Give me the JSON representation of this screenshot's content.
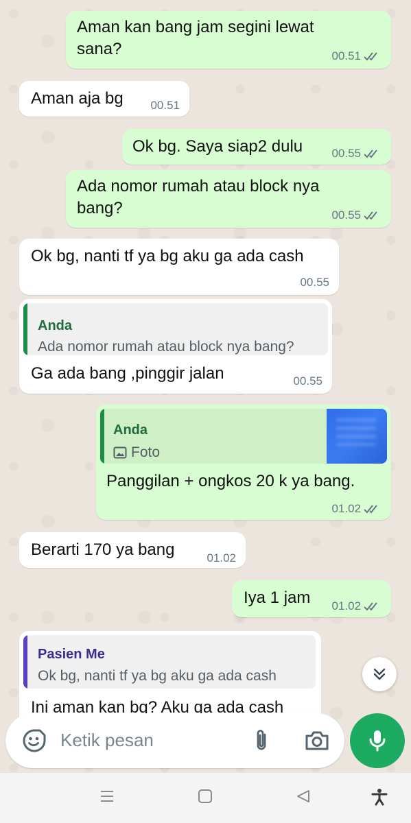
{
  "messages": [
    {
      "text": "Aman kan bang jam segini lewat\nsana?",
      "time": "00.51"
    },
    {
      "text": "Aman aja bg",
      "time": "00.51"
    },
    {
      "text": "Ok bg. Saya siap2 dulu",
      "time": "00.55"
    },
    {
      "text": "Ada nomor rumah atau block nya\nbang?",
      "time": "00.55"
    },
    {
      "text": "Ok bg, nanti tf ya bg aku ga ada cash",
      "time": "00.55"
    },
    {
      "quote_name": "Anda",
      "quote_text": "Ada nomor rumah atau block nya bang?",
      "text": "Ga ada bang ,pinggir jalan",
      "time": "00.55"
    },
    {
      "quote_name": "Anda",
      "quote_text": "Foto",
      "text": "Panggilan + ongkos 20 k ya bang.",
      "time": "01.02"
    },
    {
      "text": "Berarti 170 ya bang",
      "time": "01.02"
    },
    {
      "text": "Iya 1 jam",
      "time": "01.02"
    },
    {
      "quote_name": "Pasien Me",
      "quote_text": "Ok bg, nanti tf ya bg aku ga ada cash",
      "text": "Ini aman kan bg? Aku ga ada cash"
    }
  ],
  "input": {
    "placeholder": "Ketik pesan"
  },
  "colors": {
    "outgoing_bubble": "#d9fdd3",
    "incoming_bubble": "#ffffff",
    "quote_anda": "#1f8a4c",
    "quote_pasien": "#5a3fc0",
    "read_ticks": "#667781",
    "mic_button": "#1daa61"
  },
  "icons": {
    "read_receipt": "double-check-icon",
    "photo": "image-icon",
    "emoji": "emoji-icon",
    "attach": "paperclip-icon",
    "camera": "camera-icon",
    "mic": "microphone-icon",
    "scroll_down": "double-chevron-down-icon",
    "nav": [
      "menu-icon",
      "home-square-icon",
      "back-triangle-icon",
      "accessibility-icon"
    ]
  }
}
